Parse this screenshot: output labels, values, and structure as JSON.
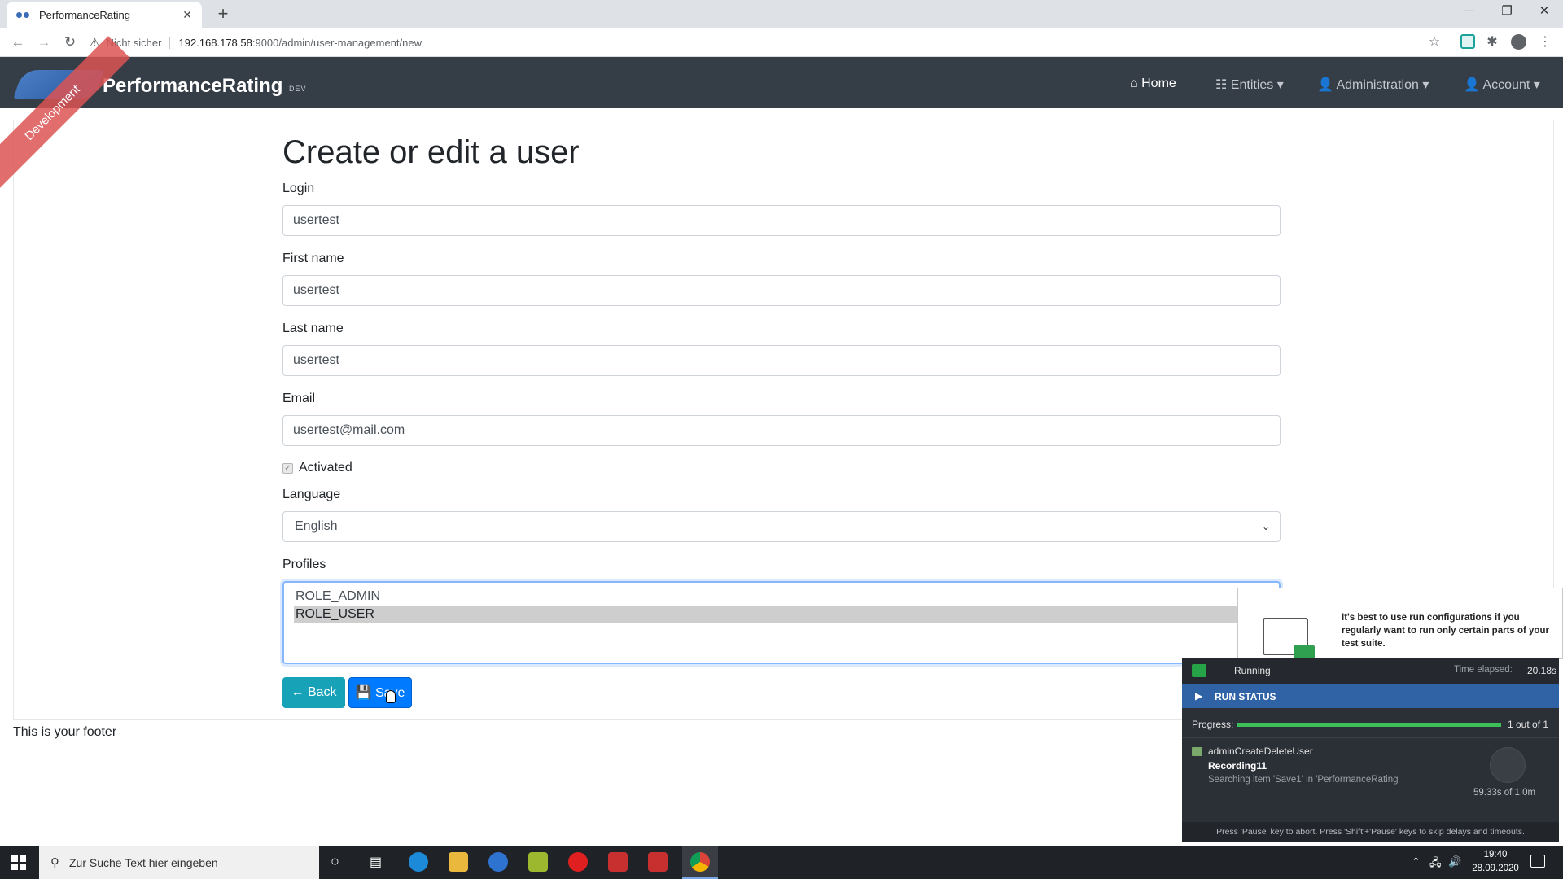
{
  "browser": {
    "tab_title": "PerformanceRating",
    "new_tab": "+",
    "tab_close": "✕",
    "security_label": "Nicht sicher",
    "url_host": "192.168.178.58",
    "url_path": ":9000/admin/user-management/new"
  },
  "app": {
    "brand": "PerformanceRating",
    "env_badge": "DEV",
    "ribbon": "Development",
    "nav": {
      "home": "Home",
      "entities": "Entities",
      "administration": "Administration",
      "account": "Account"
    }
  },
  "form": {
    "title": "Create or edit a user",
    "login_label": "Login",
    "login_value": "usertest",
    "first_name_label": "First name",
    "first_name_value": "usertest",
    "last_name_label": "Last name",
    "last_name_value": "usertest",
    "email_label": "Email",
    "email_value": "usertest@mail.com",
    "activated_label": "Activated",
    "activated": true,
    "language_label": "Language",
    "language_value": "English",
    "profiles_label": "Profiles",
    "profiles": [
      {
        "label": "ROLE_ADMIN",
        "selected": false
      },
      {
        "label": "ROLE_USER",
        "selected": true
      }
    ],
    "back_label": "Back",
    "save_label": "Save"
  },
  "footer": "This is your footer",
  "runner": {
    "tip": "It's best to use run configurations if you regularly want to run only certain parts of your test suite.",
    "status": "Running",
    "elapsed_label": "Time elapsed:",
    "elapsed_value": "20.18s",
    "section": "RUN STATUS",
    "progress_label": "Progress:",
    "progress_fraction": 1.0,
    "progress_count": "1 out of 1",
    "test_name": "adminCreateDeleteUser",
    "recording": "Recording11",
    "searching": "Searching item 'Save1' in 'PerformanceRating'",
    "timeout": "59.33s of 1.0m",
    "footer": "Press 'Pause' key to abort. Press 'Shift'+'Pause' keys to skip delays and timeouts."
  },
  "taskbar": {
    "search_placeholder": "Zur Suche Text hier eingeben",
    "time": "19:40",
    "date": "28.09.2020"
  },
  "colors": {
    "navbar": "#353d47",
    "back_button": "#17a2b8",
    "save_button": "#007bff",
    "runner_bar": "#2f63a6",
    "progress": "#3cbf5b"
  }
}
